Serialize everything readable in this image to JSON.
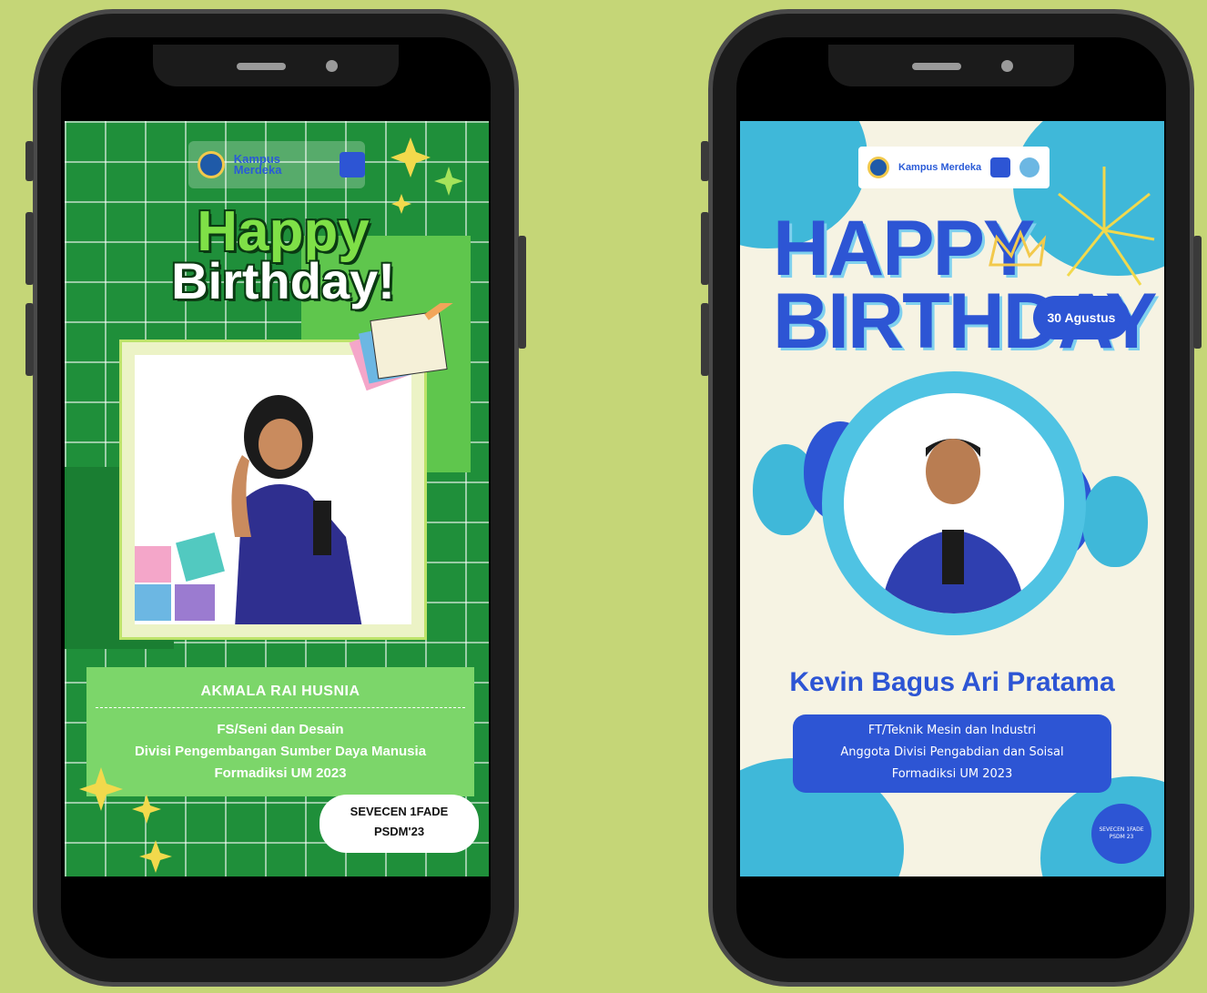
{
  "left_poster": {
    "logo_text": "Kampus Merdeka",
    "title_line1": "Happy",
    "title_line2": "Birthday!",
    "name": "AKMALA RAI HUSNIA",
    "faculty": "FS/Seni dan Desain",
    "division": "Divisi Pengembangan Sumber Daya Manusia",
    "org": "Formadiksi UM 2023",
    "tag_line1": "SEVECEN 1FADE",
    "tag_line2": "PSDM'23",
    "colors": {
      "bg": "#1f8f3a",
      "accent": "#7cd66a"
    }
  },
  "right_poster": {
    "logo_text": "Kampus Merdeka",
    "title_line1": "HAPPY",
    "title_line2": "BIRTHDAY",
    "date": "30 Agustus",
    "name": "Kevin Bagus Ari Pratama",
    "faculty": "FT/Teknik Mesin dan Industri",
    "division": "Anggota Divisi Pengabdian dan Soisal",
    "org": "Formadiksi UM 2023",
    "badge_line1": "SEVECEN 1FADE",
    "badge_line2": "PSDM 23",
    "colors": {
      "bg": "#f6f3e3",
      "accent": "#2d55d4",
      "secondary": "#3fb8d9"
    }
  }
}
